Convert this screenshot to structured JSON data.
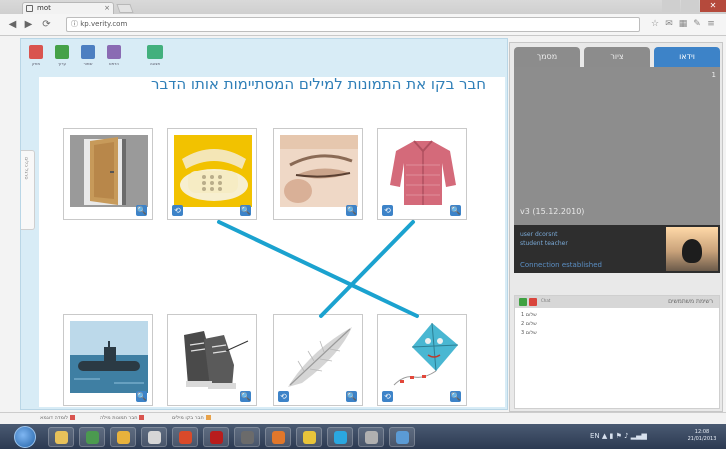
{
  "browser": {
    "tab_title": "mot",
    "tab_close": "×",
    "address": "ⓘ kp.verity.com",
    "nav_back": "◀",
    "nav_forward": "▶",
    "nav_reload": "⟳",
    "toolbar_icons": [
      "☆",
      "✉",
      "▦",
      "✎",
      "≡"
    ],
    "win_close": "✕"
  },
  "top_toolbar": {
    "tools": [
      {
        "label": "מחק",
        "color": "#d9544f"
      },
      {
        "label": "ערוך",
        "color": "#45a148"
      },
      {
        "label": "שמור",
        "color": "#4d7fc1"
      },
      {
        "label": "הדפס",
        "color": "#8a6bb3"
      },
      {
        "label": "תצוגה",
        "color": "#43b07d"
      }
    ]
  },
  "exercise": {
    "instruction": "חבר בקו את התמונות למילים המסתיימות אותו הדבר",
    "side_tab_label": "סרגל כלים",
    "zoom_glyph": "🔍",
    "swap_glyph": "⟲",
    "top_row": [
      {
        "name": "door"
      },
      {
        "name": "telephone"
      },
      {
        "name": "eye"
      },
      {
        "name": "shirt"
      }
    ],
    "bottom_row": [
      {
        "name": "submarine"
      },
      {
        "name": "shoes"
      },
      {
        "name": "feather"
      },
      {
        "name": "kite"
      }
    ],
    "matches": [
      {
        "top": "telephone",
        "bottom": "kite"
      },
      {
        "top": "shirt",
        "bottom": "feather"
      }
    ],
    "line_color": "#1ba2cf"
  },
  "right_panel": {
    "tabs": [
      "מסמך",
      "ציור",
      "וידאו"
    ],
    "active_tab": "וידאו",
    "video_number": "1",
    "version": "v3 (15.12.2010)",
    "user_lines": [
      "user   dcorsnt",
      "student  teacher"
    ],
    "connection": "Connection established",
    "chat_header_small": "Chat",
    "chat_title": "רשימת משתמשים",
    "chat_lines": [
      "1 שלום",
      "2 שלום",
      "3 שלום"
    ]
  },
  "bottom_tabs": [
    {
      "label": "לומדה דוגמא",
      "color": "#d9544f"
    },
    {
      "label": "חבר תמונות מילה",
      "color": "#d9544f"
    },
    {
      "label": "חבר בקו מילים",
      "color": "#e8a24a"
    }
  ],
  "taskbar": {
    "apps": [
      {
        "name": "explorer",
        "color": "#e7c15a"
      },
      {
        "name": "chrome",
        "color": "#4b9a4f"
      },
      {
        "name": "media",
        "color": "#e8b23c"
      },
      {
        "name": "movie",
        "color": "#d6d6d6"
      },
      {
        "name": "office",
        "color": "#d94a2a"
      },
      {
        "name": "acrobat",
        "color": "#b81d1d"
      },
      {
        "name": "tv",
        "color": "#6b6b6b"
      },
      {
        "name": "firefox",
        "color": "#e0772b"
      },
      {
        "name": "tools",
        "color": "#e8c43a"
      },
      {
        "name": "skype",
        "color": "#2aa7e0"
      },
      {
        "name": "app",
        "color": "#b0b0b0"
      },
      {
        "name": "window",
        "color": "#5b9bd5"
      }
    ],
    "tray": "EN ▲ ▮ ⚑ ♪ ▂▄▆",
    "time": "12:08",
    "date": "21/01/2013"
  }
}
